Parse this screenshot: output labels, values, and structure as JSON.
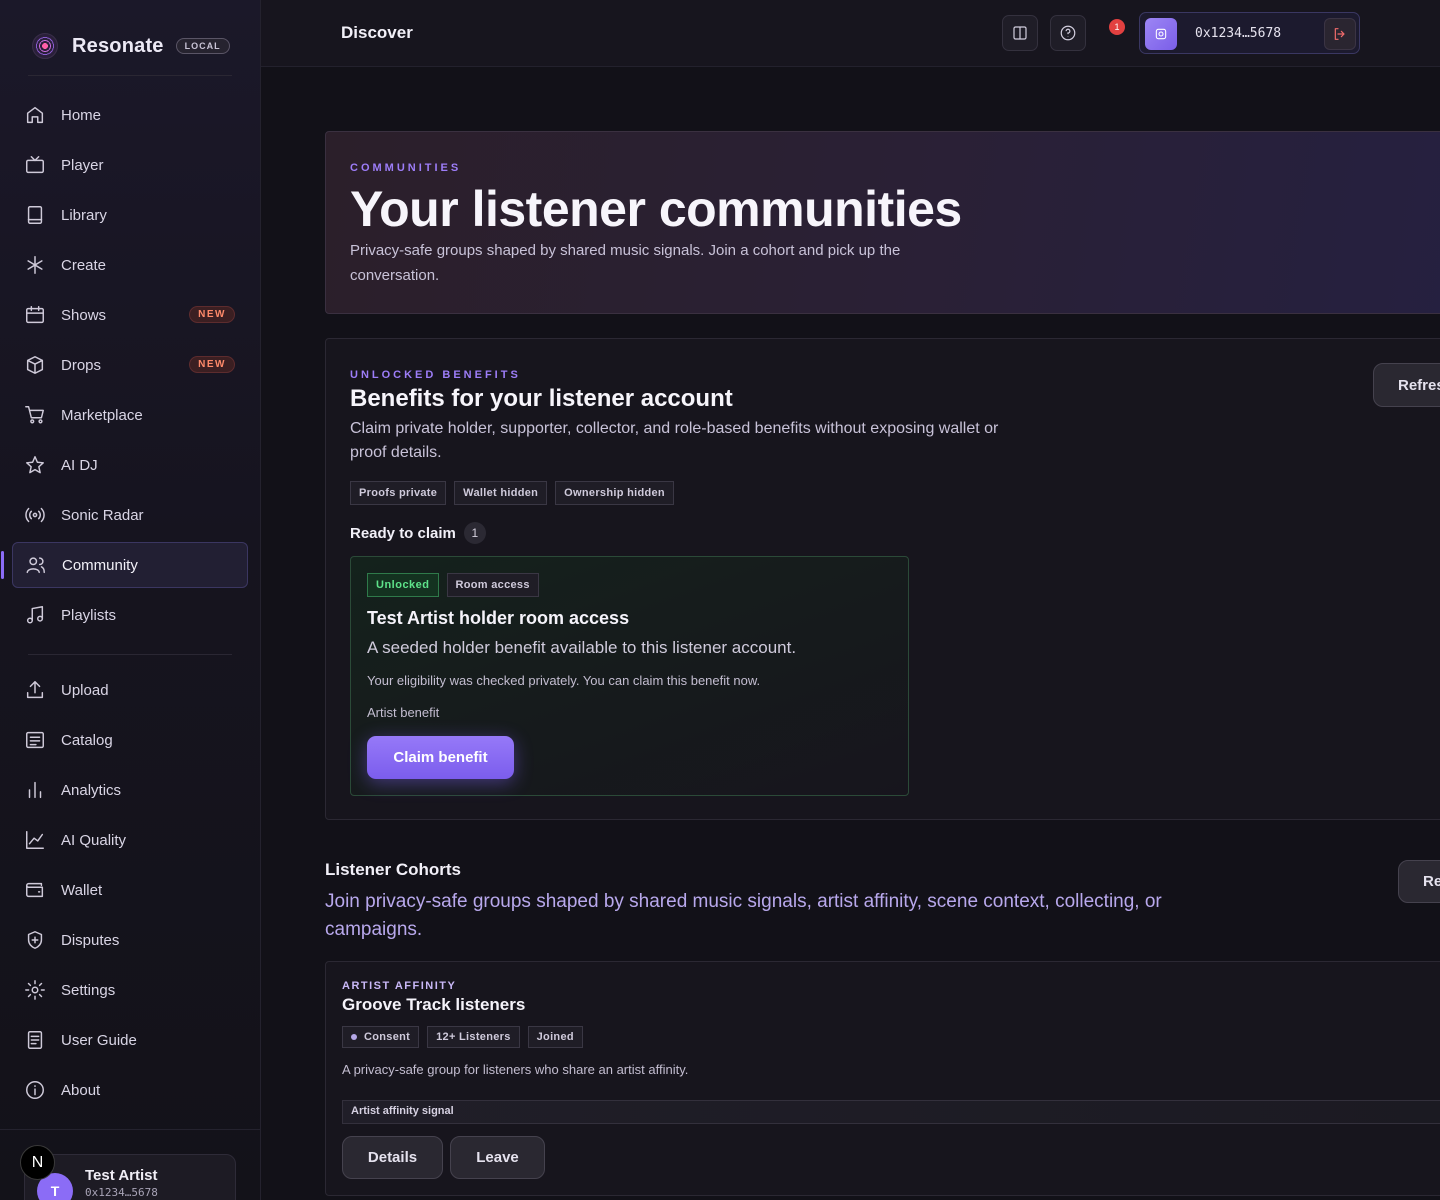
{
  "brand": {
    "name": "Resonate",
    "badge": "LOCAL"
  },
  "sidebar": {
    "items": [
      {
        "label": "Home",
        "icon": "home-icon"
      },
      {
        "label": "Player",
        "icon": "tv-icon"
      },
      {
        "label": "Library",
        "icon": "book-icon"
      },
      {
        "label": "Create",
        "icon": "asterisk-icon"
      },
      {
        "label": "Shows",
        "icon": "calendar-icon",
        "badge": "NEW"
      },
      {
        "label": "Drops",
        "icon": "box-icon",
        "badge": "NEW"
      },
      {
        "label": "Marketplace",
        "icon": "cart-icon"
      },
      {
        "label": "AI DJ",
        "icon": "star-icon"
      },
      {
        "label": "Sonic Radar",
        "icon": "radar-icon"
      },
      {
        "label": "Community",
        "icon": "users-icon",
        "active": true
      },
      {
        "label": "Playlists",
        "icon": "music-note-icon"
      },
      {
        "label": "Upload",
        "icon": "upload-icon"
      },
      {
        "label": "Catalog",
        "icon": "list-icon"
      },
      {
        "label": "Analytics",
        "icon": "bar-chart-icon"
      },
      {
        "label": "AI Quality",
        "icon": "line-chart-icon"
      },
      {
        "label": "Wallet",
        "icon": "wallet-icon"
      },
      {
        "label": "Disputes",
        "icon": "shield-icon"
      },
      {
        "label": "Settings",
        "icon": "gear-icon"
      },
      {
        "label": "User Guide",
        "icon": "document-icon"
      },
      {
        "label": "About",
        "icon": "info-icon"
      }
    ],
    "user": {
      "initial": "T",
      "name": "Test Artist",
      "address": "0x1234…5678"
    },
    "n_badge": "N"
  },
  "header": {
    "title": "Discover",
    "notification_count": "1",
    "wallet_address": "0x1234…5678"
  },
  "hero": {
    "eyebrow": "COMMUNITIES",
    "title": "Your listener communities",
    "subtitle": "Privacy-safe groups shaped by shared music signals. Join a cohort and pick up the conversation."
  },
  "benefits": {
    "eyebrow": "UNLOCKED BENEFITS",
    "title": "Benefits for your listener account",
    "subtitle": "Claim private holder, supporter, collector, and role-based benefits without exposing wallet or proof details.",
    "tags": [
      "Proofs private",
      "Wallet hidden",
      "Ownership hidden"
    ],
    "refresh_label": "Refresh",
    "ready_label": "Ready to claim",
    "ready_count": "1",
    "card": {
      "status": "Unlocked",
      "type": "Room access",
      "title": "Test Artist holder room access",
      "description": "A seeded holder benefit available to this listener account.",
      "eligibility": "Your eligibility was checked privately. You can claim this benefit now.",
      "kind": "Artist benefit",
      "claim_label": "Claim benefit"
    }
  },
  "cohorts": {
    "title": "Listener Cohorts",
    "subtitle": "Join privacy-safe groups shaped by shared music signals, artist affinity, scene context, collecting, or campaigns.",
    "refresh_label": "Refresh",
    "card": {
      "eyebrow": "ARTIST AFFINITY",
      "title": "Groove Track listeners",
      "tags": [
        "Consent",
        "12+ Listeners",
        "Joined"
      ],
      "description": "A privacy-safe group for listeners who share an artist affinity.",
      "signal": "Artist affinity signal",
      "details_label": "Details",
      "leave_label": "Leave"
    }
  },
  "colors": {
    "accent": "#8b6cf6",
    "success": "#5ee38a",
    "danger": "#e24040"
  }
}
